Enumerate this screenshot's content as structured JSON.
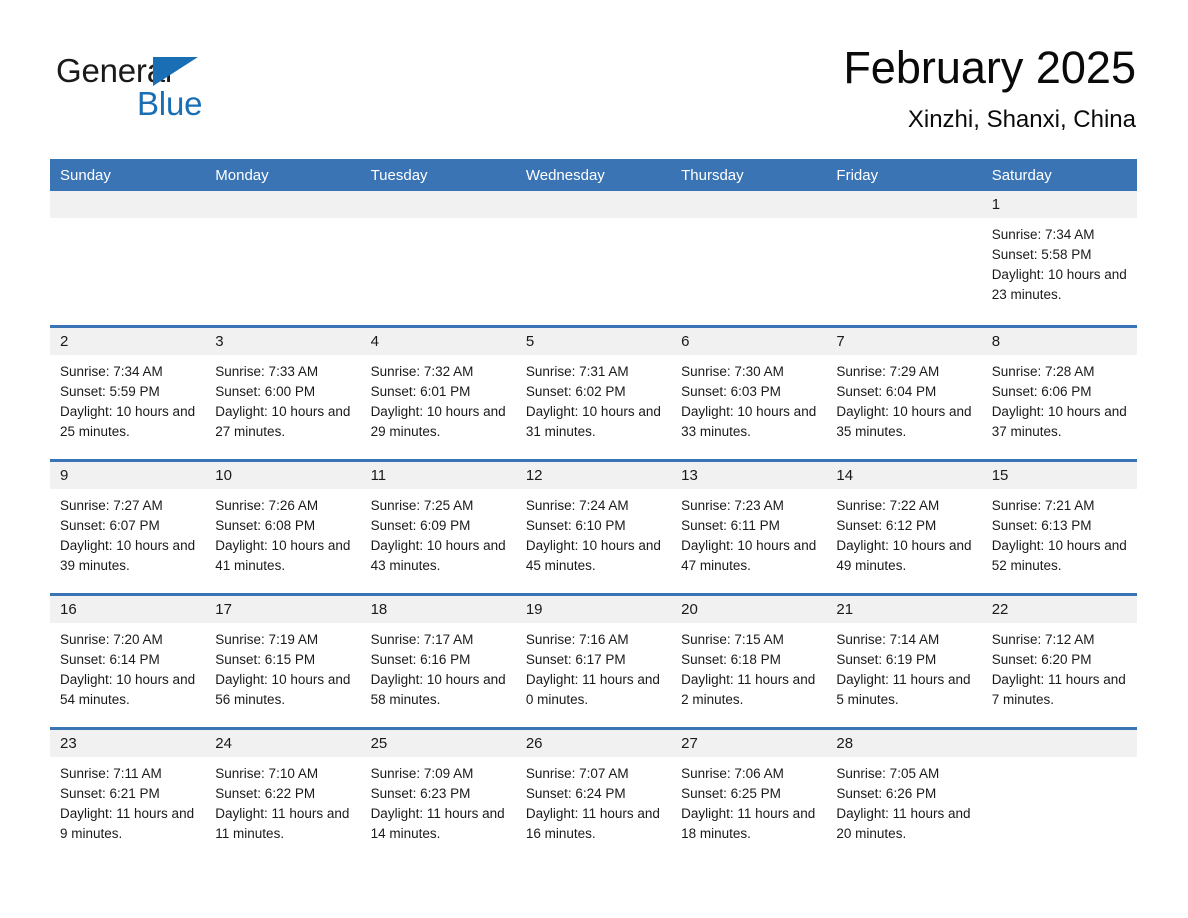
{
  "brand": {
    "name_part1": "General",
    "name_part2": "Blue",
    "accent_color": "#1a6fb4"
  },
  "header": {
    "month_title": "February 2025",
    "location": "Xinzhi, Shanxi, China"
  },
  "theme": {
    "header_blue": "#3a74b4",
    "day_band_gray": "#f1f1f1"
  },
  "calendar": {
    "weekday_headers": [
      "Sunday",
      "Monday",
      "Tuesday",
      "Wednesday",
      "Thursday",
      "Friday",
      "Saturday"
    ],
    "weeks": [
      [
        {
          "day": "",
          "sunrise": "",
          "sunset": "",
          "daylight": "",
          "blank": true
        },
        {
          "day": "",
          "sunrise": "",
          "sunset": "",
          "daylight": "",
          "blank": true
        },
        {
          "day": "",
          "sunrise": "",
          "sunset": "",
          "daylight": "",
          "blank": true
        },
        {
          "day": "",
          "sunrise": "",
          "sunset": "",
          "daylight": "",
          "blank": true
        },
        {
          "day": "",
          "sunrise": "",
          "sunset": "",
          "daylight": "",
          "blank": true
        },
        {
          "day": "",
          "sunrise": "",
          "sunset": "",
          "daylight": "",
          "blank": true
        },
        {
          "day": "1",
          "sunrise": "Sunrise: 7:34 AM",
          "sunset": "Sunset: 5:58 PM",
          "daylight": "Daylight: 10 hours and 23 minutes.",
          "blank": false
        }
      ],
      [
        {
          "day": "2",
          "sunrise": "Sunrise: 7:34 AM",
          "sunset": "Sunset: 5:59 PM",
          "daylight": "Daylight: 10 hours and 25 minutes.",
          "blank": false
        },
        {
          "day": "3",
          "sunrise": "Sunrise: 7:33 AM",
          "sunset": "Sunset: 6:00 PM",
          "daylight": "Daylight: 10 hours and 27 minutes.",
          "blank": false
        },
        {
          "day": "4",
          "sunrise": "Sunrise: 7:32 AM",
          "sunset": "Sunset: 6:01 PM",
          "daylight": "Daylight: 10 hours and 29 minutes.",
          "blank": false
        },
        {
          "day": "5",
          "sunrise": "Sunrise: 7:31 AM",
          "sunset": "Sunset: 6:02 PM",
          "daylight": "Daylight: 10 hours and 31 minutes.",
          "blank": false
        },
        {
          "day": "6",
          "sunrise": "Sunrise: 7:30 AM",
          "sunset": "Sunset: 6:03 PM",
          "daylight": "Daylight: 10 hours and 33 minutes.",
          "blank": false
        },
        {
          "day": "7",
          "sunrise": "Sunrise: 7:29 AM",
          "sunset": "Sunset: 6:04 PM",
          "daylight": "Daylight: 10 hours and 35 minutes.",
          "blank": false
        },
        {
          "day": "8",
          "sunrise": "Sunrise: 7:28 AM",
          "sunset": "Sunset: 6:06 PM",
          "daylight": "Daylight: 10 hours and 37 minutes.",
          "blank": false
        }
      ],
      [
        {
          "day": "9",
          "sunrise": "Sunrise: 7:27 AM",
          "sunset": "Sunset: 6:07 PM",
          "daylight": "Daylight: 10 hours and 39 minutes.",
          "blank": false
        },
        {
          "day": "10",
          "sunrise": "Sunrise: 7:26 AM",
          "sunset": "Sunset: 6:08 PM",
          "daylight": "Daylight: 10 hours and 41 minutes.",
          "blank": false
        },
        {
          "day": "11",
          "sunrise": "Sunrise: 7:25 AM",
          "sunset": "Sunset: 6:09 PM",
          "daylight": "Daylight: 10 hours and 43 minutes.",
          "blank": false
        },
        {
          "day": "12",
          "sunrise": "Sunrise: 7:24 AM",
          "sunset": "Sunset: 6:10 PM",
          "daylight": "Daylight: 10 hours and 45 minutes.",
          "blank": false
        },
        {
          "day": "13",
          "sunrise": "Sunrise: 7:23 AM",
          "sunset": "Sunset: 6:11 PM",
          "daylight": "Daylight: 10 hours and 47 minutes.",
          "blank": false
        },
        {
          "day": "14",
          "sunrise": "Sunrise: 7:22 AM",
          "sunset": "Sunset: 6:12 PM",
          "daylight": "Daylight: 10 hours and 49 minutes.",
          "blank": false
        },
        {
          "day": "15",
          "sunrise": "Sunrise: 7:21 AM",
          "sunset": "Sunset: 6:13 PM",
          "daylight": "Daylight: 10 hours and 52 minutes.",
          "blank": false
        }
      ],
      [
        {
          "day": "16",
          "sunrise": "Sunrise: 7:20 AM",
          "sunset": "Sunset: 6:14 PM",
          "daylight": "Daylight: 10 hours and 54 minutes.",
          "blank": false
        },
        {
          "day": "17",
          "sunrise": "Sunrise: 7:19 AM",
          "sunset": "Sunset: 6:15 PM",
          "daylight": "Daylight: 10 hours and 56 minutes.",
          "blank": false
        },
        {
          "day": "18",
          "sunrise": "Sunrise: 7:17 AM",
          "sunset": "Sunset: 6:16 PM",
          "daylight": "Daylight: 10 hours and 58 minutes.",
          "blank": false
        },
        {
          "day": "19",
          "sunrise": "Sunrise: 7:16 AM",
          "sunset": "Sunset: 6:17 PM",
          "daylight": "Daylight: 11 hours and 0 minutes.",
          "blank": false
        },
        {
          "day": "20",
          "sunrise": "Sunrise: 7:15 AM",
          "sunset": "Sunset: 6:18 PM",
          "daylight": "Daylight: 11 hours and 2 minutes.",
          "blank": false
        },
        {
          "day": "21",
          "sunrise": "Sunrise: 7:14 AM",
          "sunset": "Sunset: 6:19 PM",
          "daylight": "Daylight: 11 hours and 5 minutes.",
          "blank": false
        },
        {
          "day": "22",
          "sunrise": "Sunrise: 7:12 AM",
          "sunset": "Sunset: 6:20 PM",
          "daylight": "Daylight: 11 hours and 7 minutes.",
          "blank": false
        }
      ],
      [
        {
          "day": "23",
          "sunrise": "Sunrise: 7:11 AM",
          "sunset": "Sunset: 6:21 PM",
          "daylight": "Daylight: 11 hours and 9 minutes.",
          "blank": false
        },
        {
          "day": "24",
          "sunrise": "Sunrise: 7:10 AM",
          "sunset": "Sunset: 6:22 PM",
          "daylight": "Daylight: 11 hours and 11 minutes.",
          "blank": false
        },
        {
          "day": "25",
          "sunrise": "Sunrise: 7:09 AM",
          "sunset": "Sunset: 6:23 PM",
          "daylight": "Daylight: 11 hours and 14 minutes.",
          "blank": false
        },
        {
          "day": "26",
          "sunrise": "Sunrise: 7:07 AM",
          "sunset": "Sunset: 6:24 PM",
          "daylight": "Daylight: 11 hours and 16 minutes.",
          "blank": false
        },
        {
          "day": "27",
          "sunrise": "Sunrise: 7:06 AM",
          "sunset": "Sunset: 6:25 PM",
          "daylight": "Daylight: 11 hours and 18 minutes.",
          "blank": false
        },
        {
          "day": "28",
          "sunrise": "Sunrise: 7:05 AM",
          "sunset": "Sunset: 6:26 PM",
          "daylight": "Daylight: 11 hours and 20 minutes.",
          "blank": false
        },
        {
          "day": "",
          "sunrise": "",
          "sunset": "",
          "daylight": "",
          "blank": true
        }
      ]
    ]
  }
}
